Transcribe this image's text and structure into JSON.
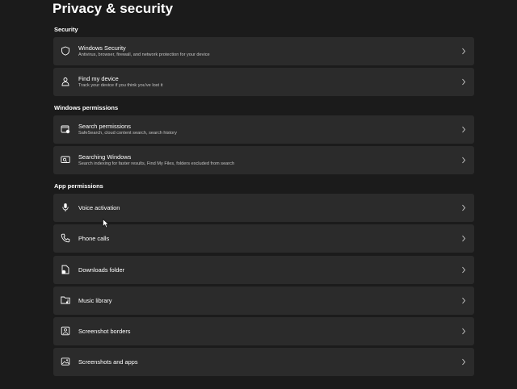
{
  "page": {
    "title": "Privacy & security"
  },
  "sections": [
    {
      "header": "Security",
      "items": [
        {
          "label": "Windows Security",
          "description": "Antivirus, browser, firewall, and network protection for your device",
          "icon": "shield-icon"
        },
        {
          "label": "Find my device",
          "description": "Track your device if you think you've lost it",
          "icon": "person-pin-icon"
        }
      ]
    },
    {
      "header": "Windows permissions",
      "items": [
        {
          "label": "Search permissions",
          "description": "SafeSearch, cloud content search, search history",
          "icon": "search-settings-icon"
        },
        {
          "label": "Searching Windows",
          "description": "Search indexing for faster results, Find My Files, folders excluded from search",
          "icon": "search-window-icon"
        }
      ]
    },
    {
      "header": "App permissions",
      "items": [
        {
          "label": "Voice activation",
          "icon": "microphone-icon"
        },
        {
          "label": "Phone calls",
          "icon": "phone-icon"
        },
        {
          "label": "Downloads folder",
          "icon": "download-file-icon"
        },
        {
          "label": "Music library",
          "icon": "music-folder-icon"
        },
        {
          "label": "Screenshot borders",
          "icon": "screenshot-border-icon"
        },
        {
          "label": "Screenshots and apps",
          "icon": "screenshot-apps-icon"
        }
      ]
    }
  ],
  "colors": {
    "background": "#1b1b1b",
    "card": "#2b2b2b",
    "text": "#ffffff",
    "subtext": "#c5c5c5"
  }
}
